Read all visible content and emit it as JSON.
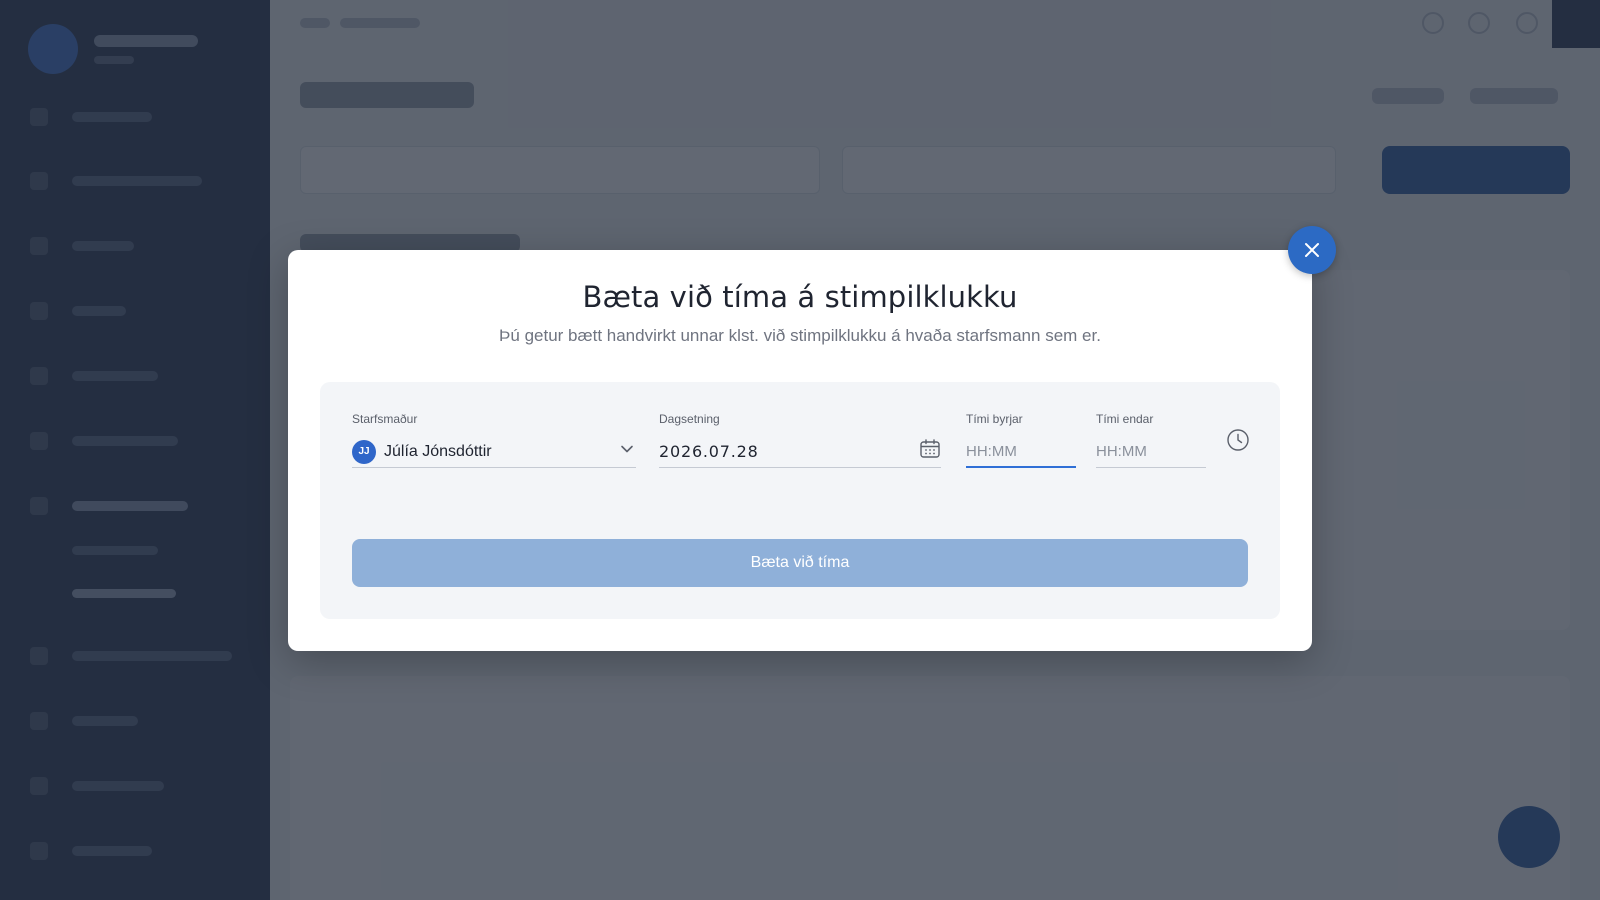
{
  "modal": {
    "title": "Bæta við tíma á stimpilklukku",
    "subtitle": "Þú getur bætt handvirkt unnar klst. við stimpilklukku á hvaða starfsmann sem er.",
    "fields": {
      "employee": {
        "label": "Starfsmaður",
        "value": "Júlía Jónsdóttir",
        "initials": "JJ"
      },
      "date": {
        "label": "Dagsetning",
        "value": "2026.07.28"
      },
      "start_time": {
        "label": "Tími byrjar",
        "placeholder": "HH:MM"
      },
      "end_time": {
        "label": "Tími endar",
        "placeholder": "HH:MM"
      }
    },
    "submit_label": "Bæta við tíma"
  },
  "colors": {
    "primary": "#2c6ac4",
    "submit_disabled": "#8fb0d9",
    "sidebar": "#1b2a4a"
  },
  "icons": [
    "close-icon",
    "chevron-down-icon",
    "calendar-icon",
    "clock-icon"
  ]
}
